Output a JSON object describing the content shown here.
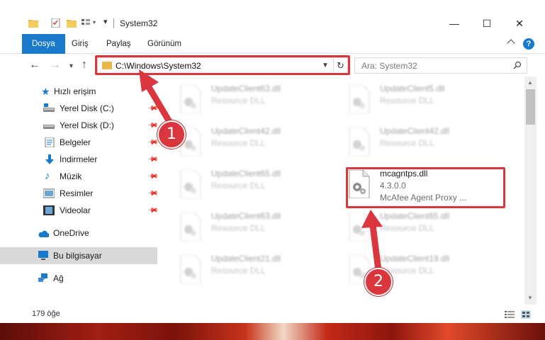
{
  "window": {
    "title": "System32",
    "minimize": "—",
    "maximize": "☐",
    "close": "✕"
  },
  "ribbon": {
    "tabs": [
      "Dosya",
      "Giriş",
      "Paylaş",
      "Görünüm"
    ],
    "help": "?"
  },
  "address": {
    "path": "C:\\Windows\\System32",
    "search_placeholder": "Ara: System32"
  },
  "sidebar": {
    "quick_access": "Hızlı erişim",
    "items": [
      {
        "label": "Yerel Disk (C:)",
        "icon": "drive-icon"
      },
      {
        "label": "Yerel Disk (D:)",
        "icon": "drive-icon"
      },
      {
        "label": "Belgeler",
        "icon": "documents-icon"
      },
      {
        "label": "İndirmeler",
        "icon": "download-icon"
      },
      {
        "label": "Müzik",
        "icon": "music-icon"
      },
      {
        "label": "Resimler",
        "icon": "pictures-icon"
      },
      {
        "label": "Videolar",
        "icon": "videos-icon"
      }
    ],
    "onedrive": "OneDrive",
    "this_pc": "Bu bilgisayar",
    "network": "Ağ"
  },
  "files": {
    "left": [
      {
        "name": "UpdateClient63.dll",
        "desc": "Resource DLL"
      },
      {
        "name": "UpdateClient42.dll",
        "desc": "Resource DLL"
      },
      {
        "name": "UpdateClient65.dll",
        "desc": "Resource DLL"
      },
      {
        "name": "UpdateClient63.dll",
        "desc": "Resource DLL"
      },
      {
        "name": "UpdateClient21.dll",
        "desc": "Resource DLL"
      }
    ],
    "right": [
      {
        "name": "UpdateClient5.dll",
        "desc": "Resource DLL"
      },
      {
        "name": "UpdateClient42.dll",
        "desc": "Resource DLL"
      },
      {
        "name": "UpdateClient65.dll",
        "desc": "Resource DLL"
      },
      {
        "name": "UpdateClient19.dll",
        "desc": "Resource DLL"
      }
    ],
    "focused": {
      "name": "mcagntps.dll",
      "version": "4.3.0.0",
      "desc": "McAfee Agent Proxy ..."
    }
  },
  "status": {
    "count": "179 öğe"
  },
  "annotations": {
    "step1": "1",
    "step2": "2",
    "color": "#d9363e"
  }
}
